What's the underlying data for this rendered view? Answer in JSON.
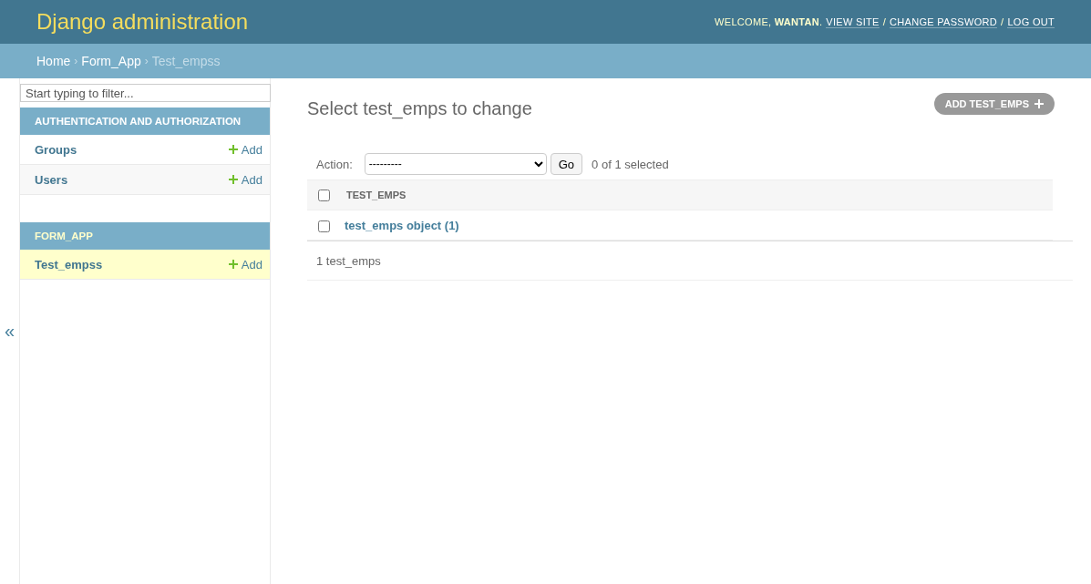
{
  "header": {
    "title": "Django administration",
    "welcome": "WELCOME, **WANTAN**.",
    "user_links": [
      {
        "label": "VIEW SITE",
        "kind": "link"
      },
      {
        "label": "/",
        "kind": "separator"
      },
      {
        "label": "CHANGE PASSWORD",
        "kind": "link"
      },
      {
        "label": "/",
        "kind": "separator"
      },
      {
        "label": "LOG OUT",
        "kind": "link"
      }
    ]
  },
  "breadcrumbs": [
    {
      "label": "Home",
      "kind": "link"
    },
    {
      "label": "›",
      "kind": "separator"
    },
    {
      "label": "Form_App",
      "kind": "link"
    },
    {
      "label": "›",
      "kind": "separator"
    },
    {
      "label": "Test_empss",
      "kind": "current"
    }
  ],
  "sidebar": {
    "toggle": "«",
    "filter": {
      "placeholder": "Start typing to filter..."
    },
    "apps": [
      {
        "title": "AUTHENTICATION AND AUTHORIZATION",
        "selected": false,
        "models": [
          {
            "name": "Groups",
            "add": "Add",
            "selected": false
          },
          {
            "name": "Users",
            "add": "Add",
            "selected": false
          }
        ]
      },
      {
        "title": "FORM_APP",
        "selected": true,
        "models": [
          {
            "name": "Test_empss",
            "add": "Add",
            "selected": true
          }
        ]
      }
    ]
  },
  "content": {
    "title": "Select test_emps to change",
    "add_button": "ADD TEST_EMPS",
    "action_label": "Action:",
    "action_value": "---------",
    "go": "Go",
    "selection_count": "0 of 1 selected",
    "table": {
      "select_all": {
        "checked": false
      },
      "columns": [
        "TEST_EMPS"
      ],
      "rows": [
        {
          "checked": false,
          "cells": [
            "test_emps object (1)"
          ]
        }
      ]
    },
    "paginator": "1 test_emps"
  }
}
